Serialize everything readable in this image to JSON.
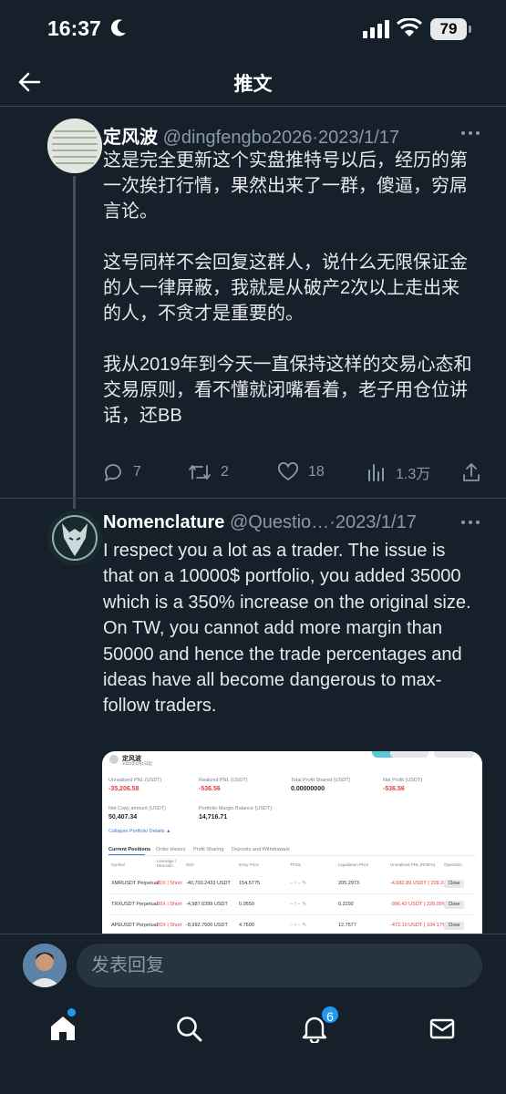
{
  "status_bar": {
    "time": "16:37",
    "battery": "79"
  },
  "header": {
    "title": "推文"
  },
  "tweet1": {
    "name": "定风波",
    "handle": "@dingfengbo2026",
    "separator": "·",
    "date": "2023/1/17",
    "paragraphs": [
      "这是完全更新这个实盘推特号以后，经历的第一次挨打行情，果然出来了一群，傻逼，穷屌言论。",
      "这号同样不会回复这群人，说什么无限保证金的人一律屏蔽，我就是从破产2次以上走出来的人，不贪才是重要的。",
      "我从2019年到今天一直保持这样的交易心态和交易原则，看不懂就闭嘴看着，老子用仓位讲话，还BB"
    ],
    "replies": "7",
    "retweets": "2",
    "likes": "18",
    "views": "1.3万"
  },
  "tweet2": {
    "name": "Nomenclature",
    "handle": "@Questio…",
    "separator": "·",
    "date": "2023/1/17",
    "text": "I respect you a lot as a trader. The issue is that on a 10000$ portfolio, you added 35000 which is a 350% increase on the original size. On TW, you cannot add more margin than 50000 and hence the trade percentages and ideas have all become dangerous to max-follow traders."
  },
  "media": {
    "profile_name": "定风波",
    "profile_sub": "2023年5月1日起",
    "stats": [
      {
        "label": "Unrealized PNL (USDT)",
        "value": "-35,206.58"
      },
      {
        "label": "Realized PNL (USDT)",
        "value": "-536.56"
      },
      {
        "label": "Total Profit Shared (USDT)",
        "value": "0.00000000"
      },
      {
        "label": "Net Profit (USDT)",
        "value": "-536.56"
      }
    ],
    "stats2": [
      {
        "label": "Net Copy amount (USDT)",
        "value": "50,407.34"
      },
      {
        "label": "Portfolio Margin Balance (USDT)",
        "value": "14,716.71"
      }
    ],
    "collapse": "Collapse Portfolio Details ▲",
    "tabs": [
      "Current Positions",
      "Order History",
      "Profit Sharing",
      "Deposits and Withdrawals"
    ],
    "columns": [
      "Symbol",
      "Leverage / Direction",
      "Size",
      "Entry Price",
      "TP/SL",
      "Liquidation Price",
      "Unrealized PNL (ROE%)",
      "Operation"
    ],
    "rows": [
      {
        "symbol": "XMRUSDT Perpetual",
        "lev": "20X | Short",
        "size": "-40,700.2433 USDT",
        "entry": "154.5775",
        "liq": "205.2973",
        "pnl": "-4,682.89 USDT ( 209.24%)",
        "op": "Close"
      },
      {
        "symbol": "TRXUSDT Perpetual",
        "lev": "20X | Short",
        "size": "-4,987.6399 USDT",
        "entry": "0.0550",
        "liq": "0.2292",
        "pnl": "-996.42 USDT ( 228.05%)",
        "op": "Close"
      },
      {
        "symbol": "APEUSDT Perpetual",
        "lev": "20X | Short",
        "size": "-8,992.7500 USDT",
        "entry": "4.7500",
        "liq": "12.7577",
        "pnl": "-472.10 USDT ( 104.17%)",
        "op": "Close"
      }
    ]
  },
  "reply": {
    "placeholder": "发表回复"
  },
  "tabbar": {
    "notifications_count": "6"
  },
  "colors": {
    "background": "#15202b",
    "accent": "#1d9bf0",
    "muted": "#8b98a5"
  }
}
